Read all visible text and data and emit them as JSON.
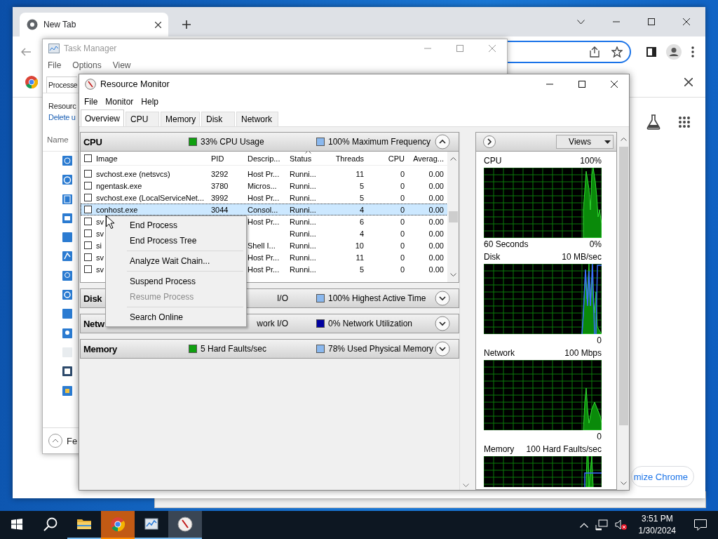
{
  "chrome": {
    "tab_title": "New Tab",
    "customize_button": "mize Chrome"
  },
  "task_manager": {
    "title": "Task Manager",
    "menu": [
      "File",
      "Options",
      "View"
    ],
    "tab": "Processe",
    "heading": "Resourc",
    "link": "Delete u",
    "column_header": "Name",
    "footer_button": "Fe"
  },
  "resource_monitor": {
    "title": "Resource Monitor",
    "menu": [
      "File",
      "Monitor",
      "Help"
    ],
    "tabs": [
      {
        "label": "Overview",
        "selected": true
      },
      {
        "label": "CPU",
        "selected": false
      },
      {
        "label": "Memory",
        "selected": false
      },
      {
        "label": "Disk",
        "selected": false
      },
      {
        "label": "Network",
        "selected": false
      }
    ],
    "sections": [
      {
        "title": "CPU",
        "expanded": true,
        "legend": [
          {
            "text": "33% CPU Usage",
            "color": "#10a010"
          },
          {
            "text": "100% Maximum Frequency",
            "color": "#8ab8ee"
          }
        ],
        "table": {
          "all_checked": false,
          "columns": [
            {
              "label": "Image",
              "sorted": false
            },
            {
              "label": "PID",
              "sorted": false
            },
            {
              "label": "Descrip...",
              "sorted": false
            },
            {
              "label": "Status",
              "sorted": true
            },
            {
              "label": "Threads",
              "sorted": false
            },
            {
              "label": "CPU",
              "sorted": false
            },
            {
              "label": "Averag...",
              "sorted": false
            }
          ],
          "rows": [
            {
              "image": "svchost.exe (netsvcs)",
              "pid": "3292",
              "description": "Host Pr...",
              "status": "Runni...",
              "threads": "11",
              "cpu": "0",
              "average": "0.00",
              "checked": false,
              "selected": false
            },
            {
              "image": "ngentask.exe",
              "pid": "3780",
              "description": "Micros...",
              "status": "Runni...",
              "threads": "5",
              "cpu": "0",
              "average": "0.00",
              "checked": false,
              "selected": false
            },
            {
              "image": "svchost.exe (LocalServiceNet...",
              "pid": "3992",
              "description": "Host Pr...",
              "status": "Runni...",
              "threads": "5",
              "cpu": "0",
              "average": "0.00",
              "checked": false,
              "selected": false
            },
            {
              "image": "conhost.exe",
              "pid": "3044",
              "description": "Consol...",
              "status": "Runni...",
              "threads": "4",
              "cpu": "0",
              "average": "0.00",
              "checked": false,
              "selected": true
            },
            {
              "image": "sv",
              "description": "Host Pr...",
              "status": "Runni...",
              "threads": "6",
              "cpu": "0",
              "average": "0.00",
              "checked": false,
              "selected": false
            },
            {
              "image": "sv",
              "status": "Runni...",
              "threads": "4",
              "cpu": "0",
              "average": "0.00",
              "checked": false,
              "selected": false
            },
            {
              "image": "si",
              "description": "Shell I...",
              "status": "Runni...",
              "threads": "10",
              "cpu": "0",
              "average": "0.00",
              "checked": false,
              "selected": false
            },
            {
              "image": "sv",
              "description": "Host Pr...",
              "status": "Runni...",
              "threads": "11",
              "cpu": "0",
              "average": "0.00",
              "checked": false,
              "selected": false
            },
            {
              "image": "sv",
              "description": "Host Pr...",
              "status": "Runni...",
              "threads": "5",
              "cpu": "0",
              "average": "0.00",
              "checked": false,
              "selected": false
            }
          ]
        }
      },
      {
        "title": "Disk",
        "expanded": false,
        "legend": [
          {
            "text": "I/O"
          },
          {
            "text": "100% Highest Active Time",
            "color": "#8ab8ee"
          }
        ]
      },
      {
        "title": "Netw",
        "expanded": false,
        "legend": [
          {
            "text": "work I/O"
          },
          {
            "text": "0% Network Utilization",
            "color": "#0000a0"
          }
        ]
      },
      {
        "title": "Memory",
        "expanded": false,
        "legend": [
          {
            "text": "5 Hard Faults/sec",
            "color": "#10a010"
          },
          {
            "text": "78% Used Physical Memory",
            "color": "#8ab8ee"
          }
        ]
      }
    ],
    "views_button": "Views",
    "graphs": [
      {
        "label": "CPU",
        "scale": "100%",
        "time_span": "60 Seconds",
        "floor": "0%"
      },
      {
        "label": "Disk",
        "scale": "10 MB/sec",
        "floor": "0"
      },
      {
        "label": "Network",
        "scale": "100 Mbps",
        "floor": "0"
      },
      {
        "label": "Memory",
        "scale": "100 Hard Faults/sec"
      }
    ]
  },
  "context_menu": {
    "groups": [
      [
        {
          "label": "End Process",
          "disabled": false
        },
        {
          "label": "End Process Tree",
          "disabled": false
        }
      ],
      [
        {
          "label": "Analyze Wait Chain...",
          "disabled": false
        }
      ],
      [
        {
          "label": "Suspend Process",
          "disabled": false
        },
        {
          "label": "Resume Process",
          "disabled": true
        }
      ],
      [
        {
          "label": "Search Online",
          "disabled": false
        }
      ]
    ]
  },
  "taskbar": {
    "apps": [
      {
        "kind": "explorer",
        "running": true,
        "selected": false,
        "flashing": false
      },
      {
        "kind": "chrome",
        "running": true,
        "selected": false,
        "flashing": true
      },
      {
        "kind": "task-manager",
        "running": true,
        "selected": false,
        "flashing": false
      },
      {
        "kind": "resource-monitor",
        "running": true,
        "selected": true,
        "flashing": false
      }
    ],
    "time": "3:51 PM",
    "date": "1/30/2024"
  }
}
